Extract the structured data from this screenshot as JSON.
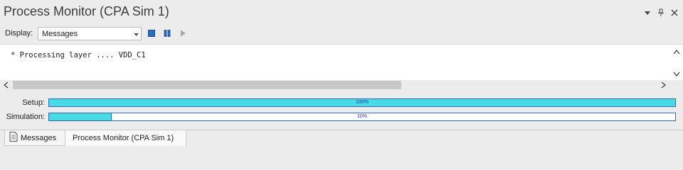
{
  "window": {
    "title": "Process Monitor (CPA Sim 1)",
    "controls": [
      {
        "name": "dropdown-icon"
      },
      {
        "name": "pin-icon"
      },
      {
        "name": "close-icon"
      }
    ]
  },
  "toolbar": {
    "display_label": "Display:",
    "display_value": "Messages",
    "buttons": [
      {
        "name": "stop-icon"
      },
      {
        "name": "pause-icon"
      },
      {
        "name": "play-icon"
      }
    ]
  },
  "log": {
    "lines": [
      "* Processing layer .... VDD_C1"
    ]
  },
  "progress": [
    {
      "label": "Setup:",
      "value": 1.0,
      "text": "100%"
    },
    {
      "label": "Simulation:",
      "value": 0.1,
      "text": "10%"
    }
  ],
  "tabs": [
    {
      "label": "Messages",
      "icon": "document-icon"
    },
    {
      "label": "Process Monitor (CPA Sim 1)"
    }
  ],
  "colors": {
    "progress_fill": "#48dbe6",
    "progress_border": "#2c6cbf",
    "accent_icon": "#2c6cbf"
  }
}
